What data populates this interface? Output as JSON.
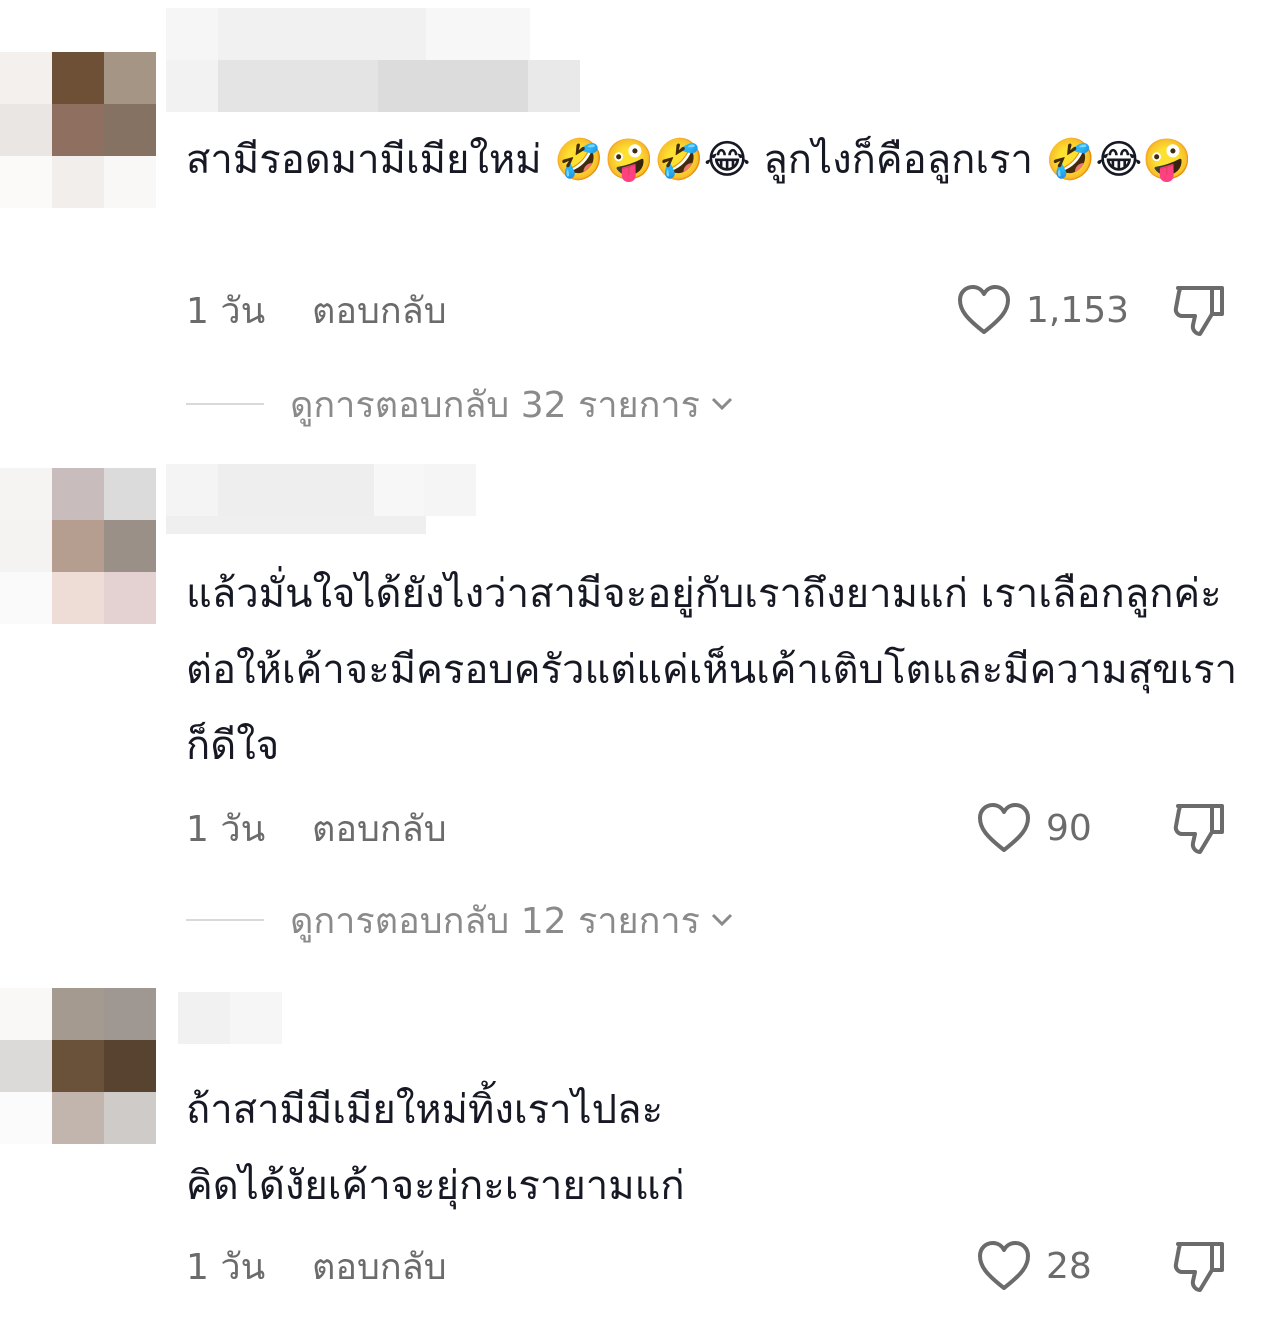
{
  "comments": [
    {
      "text": "สามีรอดมามีเมียใหม่ 🤣🤪🤣😂 ลูกไงก็คือลูกเรา 🤣😂🤪",
      "time": "1 วัน",
      "reply_label": "ตอบกลับ",
      "likes": "1,153",
      "view_replies": "ดูการตอบกลับ 32 รายการ"
    },
    {
      "text": "แล้วมั่นใจได้ยังไงว่าสามีจะอยู่กับเราถึงยามแก่ เราเลือกลูกค่ะ ต่อให้เค้าจะมีครอบครัวแต่แค่เห็นเค้าเติบโตและมีความสุขเราก็ดีใจ",
      "time": "1 วัน",
      "reply_label": "ตอบกลับ",
      "likes": "90",
      "view_replies": "ดูการตอบกลับ 12 รายการ"
    },
    {
      "text_lines": [
        "ถ้าสามีมีเมียใหม่ทิ้งเราไปละ",
        "คิดได้งัยเค้าจะยุ่กะเรายามแก่"
      ],
      "time": "1 วัน",
      "reply_label": "ตอบกลับ",
      "likes": "28"
    }
  ],
  "icons": {
    "like": "heart-outline-icon",
    "dislike": "thumbs-down-icon",
    "expand": "chevron-down-icon"
  },
  "colors": {
    "text": "#161823",
    "meta": "#6b6b6b",
    "muted": "#8a8a8a"
  }
}
